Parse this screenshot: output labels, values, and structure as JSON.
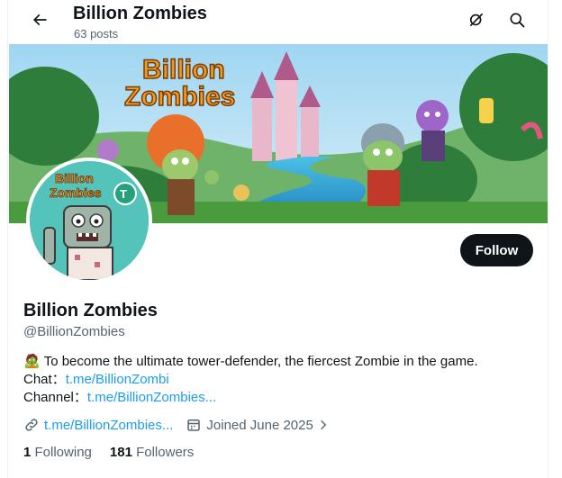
{
  "header": {
    "title": "Billion Zombies",
    "post_count": "63 posts"
  },
  "banner": {
    "logo_text_line1": "Billion",
    "logo_text_line2": "Zombies"
  },
  "avatar": {
    "logo_text_line1": "Billion",
    "logo_text_line2": "Zombies"
  },
  "actions": {
    "follow_label": "Follow"
  },
  "profile": {
    "display_name": "Billion Zombies",
    "handle": "@BillionZombies"
  },
  "bio": {
    "emoji": "🧟",
    "description": "To become the ultimate tower-defender, the fiercest Zombie in the game.",
    "chat_label": "Chat：",
    "chat_link": "t.me/BillionZombi",
    "channel_label": "Channel：",
    "channel_link": "t.me/BillionZombies..."
  },
  "meta": {
    "website": "t.me/BillionZombies...",
    "joined": "Joined June 2025"
  },
  "stats": {
    "following_count": "1",
    "following_label": "Following",
    "followers_count": "181",
    "followers_label": "Followers"
  },
  "colors": {
    "accent": "#1d9bf0",
    "text_primary": "#0f1419",
    "text_secondary": "#536471",
    "button_bg": "#0f1419"
  },
  "icons": [
    "back-arrow-icon",
    "grok-icon",
    "search-icon",
    "link-icon",
    "calendar-icon",
    "chevron-right-icon"
  ]
}
